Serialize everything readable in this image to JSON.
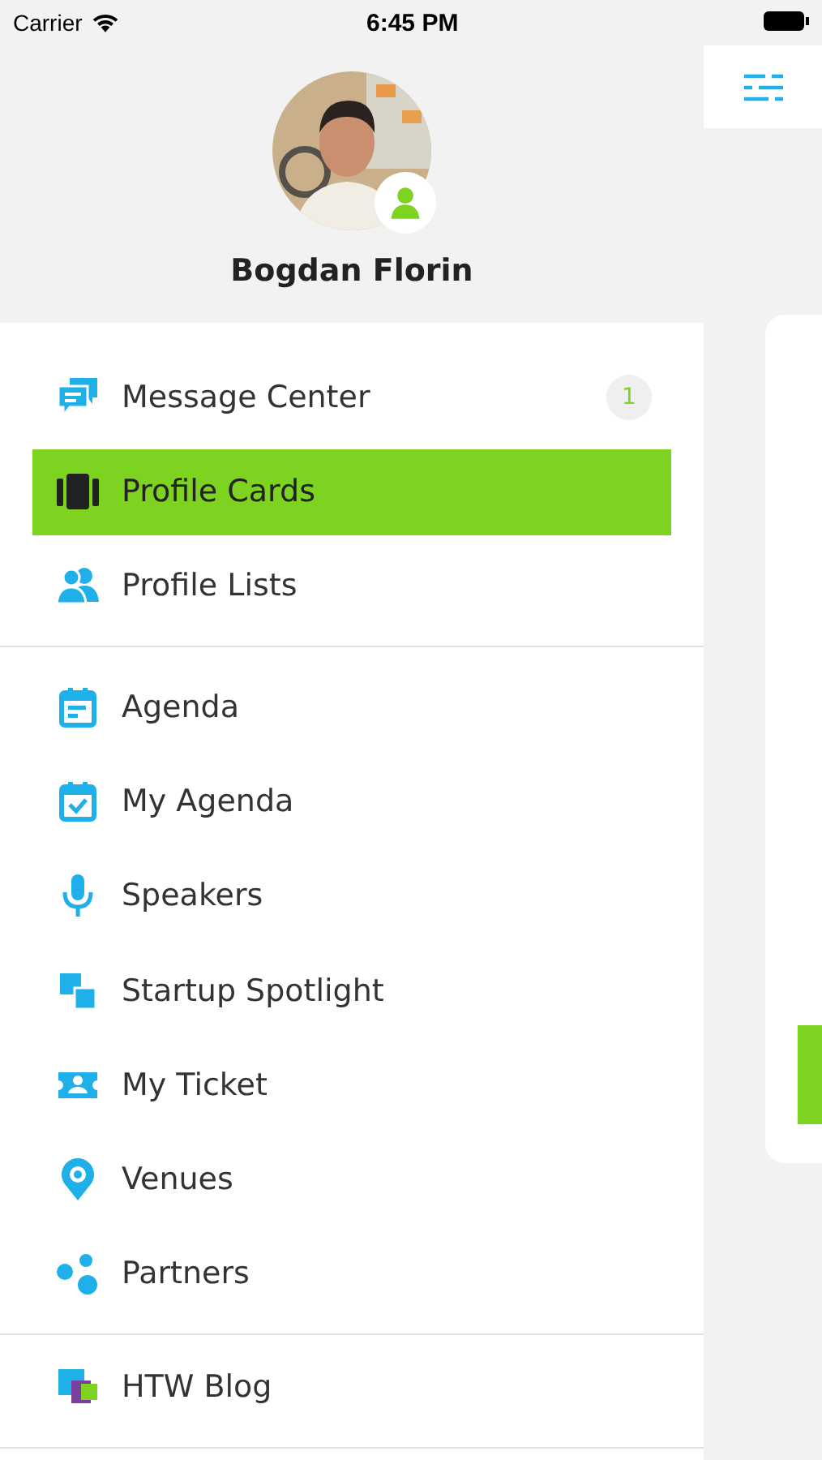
{
  "status_bar": {
    "carrier": "Carrier",
    "time": "6:45 PM"
  },
  "profile": {
    "name": "Bogdan Florin"
  },
  "menu": [
    [
      {
        "label": "Message Center",
        "selected": false,
        "badge": "1"
      },
      {
        "label": "Profile Cards",
        "selected": true
      },
      {
        "label": "Profile Lists",
        "selected": false
      }
    ],
    [
      {
        "label": "Agenda",
        "selected": false
      },
      {
        "label": "My Agenda",
        "selected": false
      },
      {
        "label": "Speakers",
        "selected": false
      },
      {
        "label": "Startup Spotlight",
        "selected": false
      },
      {
        "label": "My Ticket",
        "selected": false
      },
      {
        "label": "Venues",
        "selected": false
      },
      {
        "label": "Partners",
        "selected": false
      }
    ],
    [
      {
        "label": "HTW Blog",
        "selected": false
      }
    ]
  ]
}
